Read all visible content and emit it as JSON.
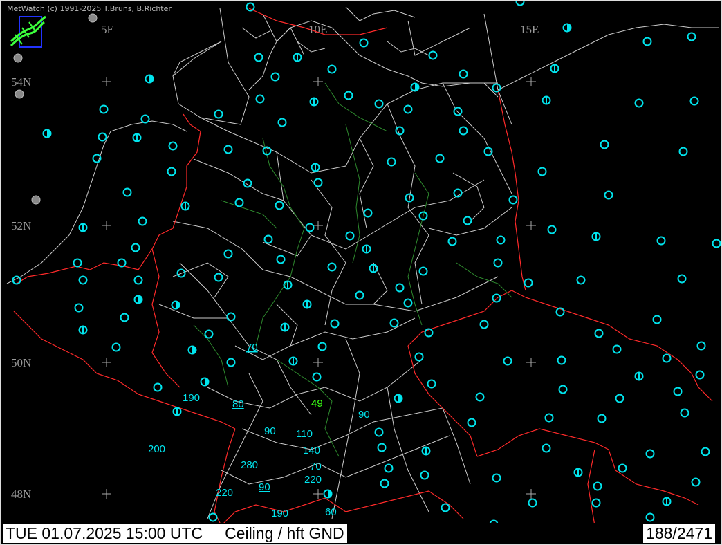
{
  "app": {
    "copyright": "MetWatch  (c) 1991-2025 T.Bruns, B.Richter"
  },
  "status_bar": {
    "datetime": "TUE 01.07.2025 15:00 UTC",
    "parameter": "Ceiling / hft GND",
    "station_count": "188/2471"
  },
  "colors": {
    "background": "#000000",
    "station": "#00e5ee",
    "value_label": "#00e5ee",
    "highlight_value": "#39ff14",
    "country_border": "#ff2a2a",
    "region_border": "#cccccc",
    "river": "#2e8b2e",
    "grid_label": "#999999"
  },
  "grid_labels": {
    "longitudes": [
      "5E",
      "10E",
      "15E"
    ],
    "latitudes": [
      "54N",
      "52N",
      "50N",
      "48N"
    ]
  },
  "stations": {
    "clear_count": 120,
    "overcast_count": 40,
    "partly_count": 11,
    "missing_count": 3
  },
  "ceiling_labels": [
    {
      "text": "70",
      "underline": true
    },
    {
      "text": "190",
      "underline": false
    },
    {
      "text": "80",
      "underline": true
    },
    {
      "text": "49",
      "underline": false,
      "highlight": true
    },
    {
      "text": "90",
      "underline": false
    },
    {
      "text": "90",
      "underline": false
    },
    {
      "text": "110",
      "underline": false
    },
    {
      "text": "200",
      "underline": false
    },
    {
      "text": "140",
      "underline": false
    },
    {
      "text": "280",
      "underline": false
    },
    {
      "text": "70",
      "underline": false
    },
    {
      "text": "220",
      "underline": false
    },
    {
      "text": "90",
      "underline": true
    },
    {
      "text": "220",
      "underline": false
    },
    {
      "text": "190",
      "underline": false
    },
    {
      "text": "60",
      "underline": false
    }
  ]
}
